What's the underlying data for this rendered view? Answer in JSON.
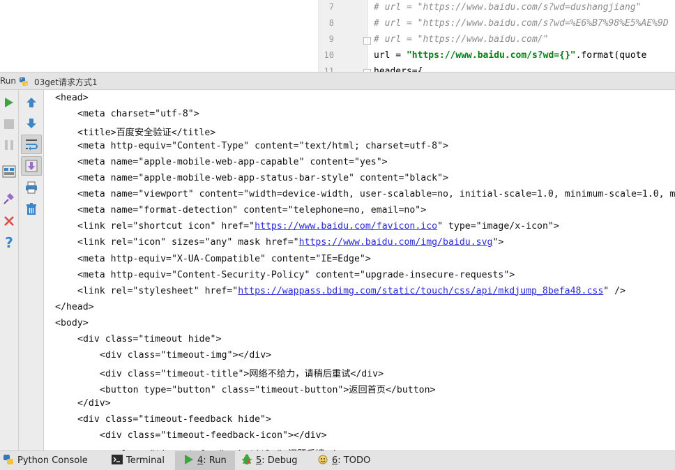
{
  "editor": {
    "line_numbers": [
      "7",
      "8",
      "9",
      "10",
      "11"
    ],
    "lines": [
      {
        "kind": "comment",
        "text": "# url = \"https://www.baidu.com/s?wd=dushangjiang\""
      },
      {
        "kind": "comment",
        "text": "# url = \"https://www.baidu.com/s?wd=%E6%B7%98%E5%AE%9D"
      },
      {
        "kind": "comment",
        "text": "# url = \"https://www.baidu.com/\""
      },
      {
        "kind": "code",
        "prefix": "url = ",
        "string": "\"https://www.baidu.com/s?wd={}\"",
        "suffix": ".format(quote"
      },
      {
        "kind": "code",
        "prefix": "headers={",
        "string": "",
        "suffix": ""
      }
    ]
  },
  "run_panel": {
    "label": "Run",
    "config_name": "03get请求方式1"
  },
  "toolbar": {
    "rerun": "rerun-icon",
    "stop": "stop-icon",
    "pause": "pause-icon",
    "dump_threads": "dump-threads-icon",
    "pin": "pin-icon",
    "close": "close-icon",
    "help": "help-icon",
    "up": "up-arrow-icon",
    "down": "down-arrow-icon",
    "soft_wrap": "soft-wrap-icon",
    "scroll_to_end": "scroll-to-end-icon",
    "print": "print-icon",
    "clear": "trash-icon"
  },
  "console": {
    "lines": [
      {
        "indent": 0,
        "parts": [
          {
            "t": "<head>"
          }
        ]
      },
      {
        "indent": 1,
        "parts": [
          {
            "t": "<meta charset=\"utf-8\">"
          }
        ]
      },
      {
        "indent": 1,
        "parts": [
          {
            "t": "<title>百度安全验证</title>"
          }
        ]
      },
      {
        "indent": 1,
        "parts": [
          {
            "t": "<meta http-equiv=\"Content-Type\" content=\"text/html; charset=utf-8\">"
          }
        ]
      },
      {
        "indent": 1,
        "parts": [
          {
            "t": "<meta name=\"apple-mobile-web-app-capable\" content=\"yes\">"
          }
        ]
      },
      {
        "indent": 1,
        "parts": [
          {
            "t": "<meta name=\"apple-mobile-web-app-status-bar-style\" content=\"black\">"
          }
        ]
      },
      {
        "indent": 1,
        "parts": [
          {
            "t": "<meta name=\"viewport\" content=\"width=device-width, user-scalable=no, initial-scale=1.0, minimum-scale=1.0, m"
          }
        ]
      },
      {
        "indent": 1,
        "parts": [
          {
            "t": "<meta name=\"format-detection\" content=\"telephone=no, email=no\">"
          }
        ]
      },
      {
        "indent": 1,
        "parts": [
          {
            "t": "<link rel=\"shortcut icon\" href=\""
          },
          {
            "link": "https://www.baidu.com/favicon.ico"
          },
          {
            "t": "\" type=\"image/x-icon\">"
          }
        ]
      },
      {
        "indent": 1,
        "parts": [
          {
            "t": "<link rel=\"icon\" sizes=\"any\" mask href=\""
          },
          {
            "link": "https://www.baidu.com/img/baidu.svg"
          },
          {
            "t": "\">"
          }
        ]
      },
      {
        "indent": 1,
        "parts": [
          {
            "t": "<meta http-equiv=\"X-UA-Compatible\" content=\"IE=Edge\">"
          }
        ]
      },
      {
        "indent": 1,
        "parts": [
          {
            "t": "<meta http-equiv=\"Content-Security-Policy\" content=\"upgrade-insecure-requests\">"
          }
        ]
      },
      {
        "indent": 1,
        "parts": [
          {
            "t": "<link rel=\"stylesheet\" href=\""
          },
          {
            "link": "https://wappass.bdimg.com/static/touch/css/api/mkdjump_8befa48.css"
          },
          {
            "t": "\" />"
          }
        ]
      },
      {
        "indent": 0,
        "parts": [
          {
            "t": "</head>"
          }
        ]
      },
      {
        "indent": 0,
        "parts": [
          {
            "t": "<body>"
          }
        ]
      },
      {
        "indent": 1,
        "parts": [
          {
            "t": "<div class=\"timeout hide\">"
          }
        ]
      },
      {
        "indent": 2,
        "parts": [
          {
            "t": "<div class=\"timeout-img\"></div>"
          }
        ]
      },
      {
        "indent": 2,
        "parts": [
          {
            "t": "<div class=\"timeout-title\">网络不给力，请稍后重试</div>"
          }
        ]
      },
      {
        "indent": 2,
        "parts": [
          {
            "t": "<button type=\"button\" class=\"timeout-button\">返回首页</button>"
          }
        ]
      },
      {
        "indent": 1,
        "parts": [
          {
            "t": "</div>"
          }
        ]
      },
      {
        "indent": 1,
        "parts": [
          {
            "t": "<div class=\"timeout-feedback hide\">"
          }
        ]
      },
      {
        "indent": 2,
        "parts": [
          {
            "t": "<div class=\"timeout-feedback-icon\"></div>"
          }
        ]
      },
      {
        "indent": 2,
        "parts": [
          {
            "t": "<p class=\"timeout-feedback-title\">问题反馈</p>"
          }
        ]
      }
    ]
  },
  "bottom_tabs": [
    {
      "name": "tab-python-console",
      "icon": "python-icon",
      "num": "",
      "label": "Python Console",
      "active": false
    },
    {
      "name": "tab-terminal",
      "icon": "terminal-icon",
      "num": "",
      "label": "Terminal",
      "active": false
    },
    {
      "name": "tab-run",
      "icon": "run-icon",
      "num": "4",
      "label": ": Run",
      "active": true
    },
    {
      "name": "tab-debug",
      "icon": "bug-icon",
      "num": "5",
      "label": ": Debug",
      "active": false
    },
    {
      "name": "tab-todo",
      "icon": "todo-icon",
      "num": "6",
      "label": ": TODO",
      "active": false
    }
  ],
  "colors": {
    "comment": "#8c8c8c",
    "string": "#067d17",
    "link": "#2a2ad8",
    "run_green": "#3ca53c",
    "close_red": "#e04848",
    "blue": "#3a86c8"
  }
}
